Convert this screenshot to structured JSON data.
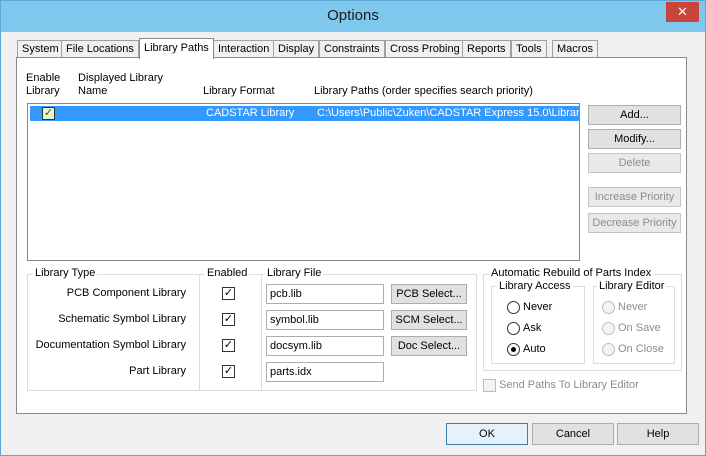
{
  "window": {
    "title": "Options",
    "close_glyph": "✕"
  },
  "tabs": [
    {
      "label": "System"
    },
    {
      "label": "File Locations"
    },
    {
      "label": "Library Paths"
    },
    {
      "label": "Interaction"
    },
    {
      "label": "Display"
    },
    {
      "label": "Constraints"
    },
    {
      "label": "Cross Probing"
    },
    {
      "label": "Reports"
    },
    {
      "label": "Tools"
    },
    {
      "label": "Macros"
    }
  ],
  "active_tab": "Library Paths",
  "library_list": {
    "headers": {
      "enable": "Enable\nLibrary",
      "name": "Displayed Library\nName",
      "format": "Library Format",
      "paths": "Library Paths (order specifies search priority)"
    },
    "rows": [
      {
        "enabled": true,
        "name": "",
        "format": "CADSTAR Library",
        "path": "C:\\Users\\Public\\Zuken\\CADSTAR Express 15.0\\Librar",
        "selected": true
      }
    ]
  },
  "side_buttons": {
    "add": "Add...",
    "modify": "Modify...",
    "delete": "Delete",
    "increase": "Increase Priority",
    "decrease": "Decrease Priority"
  },
  "library_table": {
    "col_type": "Library Type",
    "col_enabled": "Enabled",
    "col_file": "Library File",
    "rows": [
      {
        "type": "PCB Component Library",
        "enabled": true,
        "file": "pcb.lib",
        "button": "PCB Select..."
      },
      {
        "type": "Schematic Symbol Library",
        "enabled": true,
        "file": "symbol.lib",
        "button": "SCM Select..."
      },
      {
        "type": "Documentation Symbol Library",
        "enabled": true,
        "file": "docsym.lib",
        "button": "Doc Select..."
      },
      {
        "type": "Part Library",
        "enabled": true,
        "file": "parts.idx",
        "button": ""
      }
    ]
  },
  "rebuild": {
    "title": "Automatic Rebuild of Parts Index",
    "library_access": {
      "title": "Library Access",
      "options": [
        "Never",
        "Ask",
        "Auto"
      ],
      "selected": "Auto"
    },
    "library_editor": {
      "title": "Library Editor",
      "options": [
        "Never",
        "On Save",
        "On Close"
      ],
      "disabled": true
    }
  },
  "send_paths": {
    "label": "Send Paths To Library Editor",
    "checked": false,
    "disabled": true
  },
  "footer": {
    "ok": "OK",
    "cancel": "Cancel",
    "help": "Help"
  }
}
